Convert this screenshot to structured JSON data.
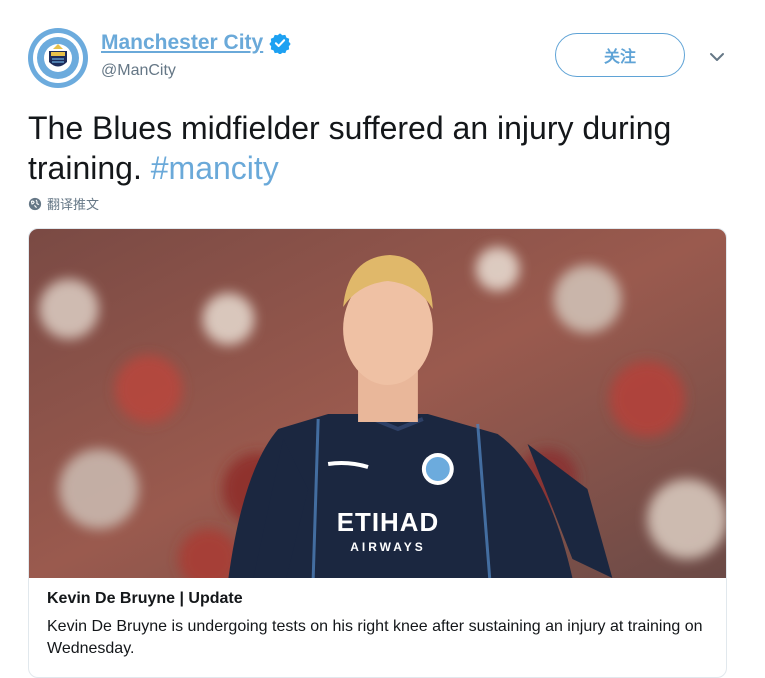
{
  "account": {
    "display_name": "Manchester City",
    "handle": "@ManCity",
    "badge_text": "MANCHESTER CITY",
    "verified": true
  },
  "follow_button": {
    "label": "关注"
  },
  "tweet": {
    "text": "The Blues midfielder suffered an injury during training.",
    "hashtag": "#mancity",
    "translate_label": "翻译推文"
  },
  "card": {
    "title": "Kevin De Bruyne | Update",
    "description": "Kevin De Bruyne is undergoing tests on his right knee after sustaining an injury at training on Wednesday.",
    "shirt_sponsor": "ETIHAD",
    "shirt_sponsor_sub": "AIRWAYS"
  },
  "colors": {
    "link": "#6aa9d9",
    "follow_border": "#5fa3d6",
    "verified": "#1da1f2",
    "text": "#14171a",
    "muted": "#657786"
  }
}
